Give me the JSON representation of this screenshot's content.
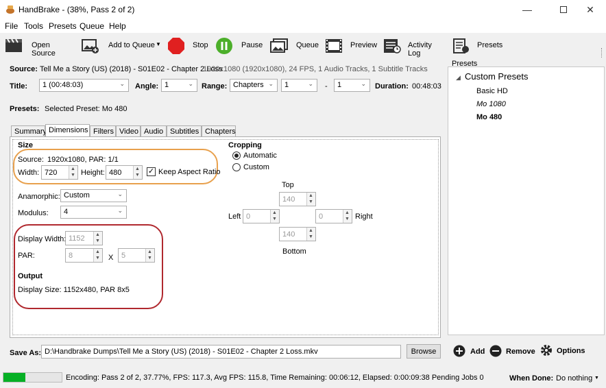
{
  "title": "HandBrake - (38%, Pass 2 of 2)",
  "menu": [
    "File",
    "Tools",
    "Presets",
    "Queue",
    "Help"
  ],
  "toolbar": {
    "open_source": "Open Source",
    "add_to_queue": "Add to Queue",
    "stop": "Stop",
    "pause": "Pause",
    "queue": "Queue",
    "preview": "Preview",
    "activity_log": "Activity Log",
    "presets": "Presets"
  },
  "source": {
    "label": "Source:",
    "name": "Tell Me a Story (US) (2018) - S01E02 - Chapter 2 Loss",
    "info": "1920x1080 (1920x1080), 24 FPS, 1 Audio Tracks, 1 Subtitle Tracks"
  },
  "title_row": {
    "title_label": "Title:",
    "title_value": "1 (00:48:03)",
    "angle_label": "Angle:",
    "angle_value": "1",
    "range_label": "Range:",
    "range_value": "Chapters",
    "range_from": "1",
    "range_dash": "-",
    "range_to": "1",
    "duration_label": "Duration:",
    "duration_value": "00:48:03"
  },
  "presets_row": {
    "label": "Presets:",
    "value": "Selected Preset: Mo 480"
  },
  "tabs": [
    "Summary",
    "Dimensions",
    "Filters",
    "Video",
    "Audio",
    "Subtitles",
    "Chapters"
  ],
  "dims": {
    "size_head": "Size",
    "source_label": "Source:",
    "source_value": "1920x1080, PAR: 1/1",
    "width_label": "Width:",
    "width_value": "720",
    "height_label": "Height:",
    "height_value": "480",
    "keep_aspect": "Keep Aspect Ratio",
    "anamorphic_label": "Anamorphic:",
    "anamorphic_value": "Custom",
    "modulus_label": "Modulus:",
    "modulus_value": "4",
    "display_width_label": "Display Width:",
    "display_width_value": "1152",
    "par_label": "PAR:",
    "par_x": "8",
    "par_sep": "X",
    "par_y": "5",
    "output_head": "Output",
    "output_value": "Display Size: 1152x480,  PAR 8x5",
    "cropping_head": "Cropping",
    "crop_auto": "Automatic",
    "crop_custom": "Custom",
    "top_label": "Top",
    "top_value": "140",
    "left_label": "Left",
    "left_value": "0",
    "right_value": "0",
    "right_label": "Right",
    "bottom_value": "140",
    "bottom_label": "Bottom"
  },
  "save": {
    "label": "Save As:",
    "path": "D:\\Handbrake Dumps\\Tell Me a Story (US) (2018) - S01E02 - Chapter 2 Loss.mkv",
    "browse": "Browse"
  },
  "presets_panel": {
    "header": "Presets",
    "group": "Custom Presets",
    "items": [
      "Basic HD",
      "Mo 1080",
      "Mo 480"
    ],
    "add": "Add",
    "remove": "Remove",
    "options": "Options"
  },
  "status": {
    "progress": 0.38,
    "text": "Encoding: Pass 2 of 2,  37.77%, FPS: 117.3,  Avg FPS: 115.8,  Time Remaining: 00:06:12,  Elapsed: 0:00:09:38   Pending Jobs 0",
    "when_done_label": "When Done:",
    "when_done_value": "Do nothing"
  },
  "colors": {
    "highlight_orange": "#e8a04c",
    "highlight_red": "#b0282e",
    "stop_red": "#e02020",
    "pause_green": "#4caf2a",
    "progress_green": "#06b025"
  }
}
